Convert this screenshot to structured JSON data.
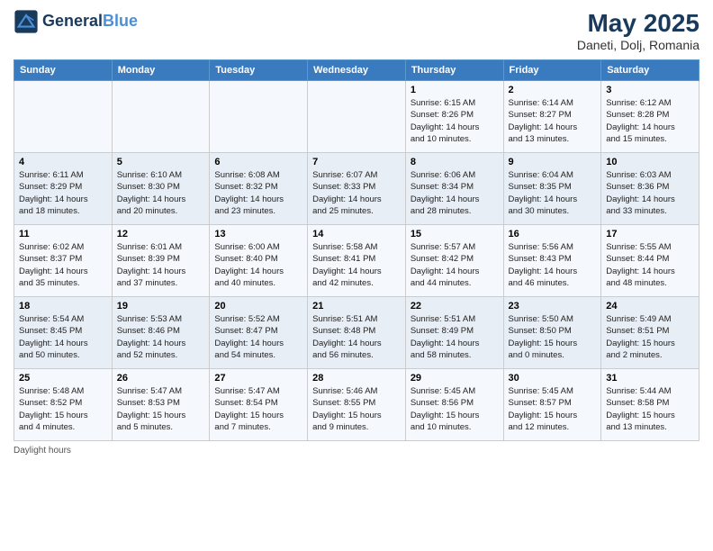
{
  "header": {
    "logo_line1": "General",
    "logo_line2": "Blue",
    "title": "May 2025",
    "location": "Daneti, Dolj, Romania"
  },
  "days_of_week": [
    "Sunday",
    "Monday",
    "Tuesday",
    "Wednesday",
    "Thursday",
    "Friday",
    "Saturday"
  ],
  "weeks": [
    [
      {
        "day": "",
        "info": ""
      },
      {
        "day": "",
        "info": ""
      },
      {
        "day": "",
        "info": ""
      },
      {
        "day": "",
        "info": ""
      },
      {
        "day": "1",
        "info": "Sunrise: 6:15 AM\nSunset: 8:26 PM\nDaylight: 14 hours\nand 10 minutes."
      },
      {
        "day": "2",
        "info": "Sunrise: 6:14 AM\nSunset: 8:27 PM\nDaylight: 14 hours\nand 13 minutes."
      },
      {
        "day": "3",
        "info": "Sunrise: 6:12 AM\nSunset: 8:28 PM\nDaylight: 14 hours\nand 15 minutes."
      }
    ],
    [
      {
        "day": "4",
        "info": "Sunrise: 6:11 AM\nSunset: 8:29 PM\nDaylight: 14 hours\nand 18 minutes."
      },
      {
        "day": "5",
        "info": "Sunrise: 6:10 AM\nSunset: 8:30 PM\nDaylight: 14 hours\nand 20 minutes."
      },
      {
        "day": "6",
        "info": "Sunrise: 6:08 AM\nSunset: 8:32 PM\nDaylight: 14 hours\nand 23 minutes."
      },
      {
        "day": "7",
        "info": "Sunrise: 6:07 AM\nSunset: 8:33 PM\nDaylight: 14 hours\nand 25 minutes."
      },
      {
        "day": "8",
        "info": "Sunrise: 6:06 AM\nSunset: 8:34 PM\nDaylight: 14 hours\nand 28 minutes."
      },
      {
        "day": "9",
        "info": "Sunrise: 6:04 AM\nSunset: 8:35 PM\nDaylight: 14 hours\nand 30 minutes."
      },
      {
        "day": "10",
        "info": "Sunrise: 6:03 AM\nSunset: 8:36 PM\nDaylight: 14 hours\nand 33 minutes."
      }
    ],
    [
      {
        "day": "11",
        "info": "Sunrise: 6:02 AM\nSunset: 8:37 PM\nDaylight: 14 hours\nand 35 minutes."
      },
      {
        "day": "12",
        "info": "Sunrise: 6:01 AM\nSunset: 8:39 PM\nDaylight: 14 hours\nand 37 minutes."
      },
      {
        "day": "13",
        "info": "Sunrise: 6:00 AM\nSunset: 8:40 PM\nDaylight: 14 hours\nand 40 minutes."
      },
      {
        "day": "14",
        "info": "Sunrise: 5:58 AM\nSunset: 8:41 PM\nDaylight: 14 hours\nand 42 minutes."
      },
      {
        "day": "15",
        "info": "Sunrise: 5:57 AM\nSunset: 8:42 PM\nDaylight: 14 hours\nand 44 minutes."
      },
      {
        "day": "16",
        "info": "Sunrise: 5:56 AM\nSunset: 8:43 PM\nDaylight: 14 hours\nand 46 minutes."
      },
      {
        "day": "17",
        "info": "Sunrise: 5:55 AM\nSunset: 8:44 PM\nDaylight: 14 hours\nand 48 minutes."
      }
    ],
    [
      {
        "day": "18",
        "info": "Sunrise: 5:54 AM\nSunset: 8:45 PM\nDaylight: 14 hours\nand 50 minutes."
      },
      {
        "day": "19",
        "info": "Sunrise: 5:53 AM\nSunset: 8:46 PM\nDaylight: 14 hours\nand 52 minutes."
      },
      {
        "day": "20",
        "info": "Sunrise: 5:52 AM\nSunset: 8:47 PM\nDaylight: 14 hours\nand 54 minutes."
      },
      {
        "day": "21",
        "info": "Sunrise: 5:51 AM\nSunset: 8:48 PM\nDaylight: 14 hours\nand 56 minutes."
      },
      {
        "day": "22",
        "info": "Sunrise: 5:51 AM\nSunset: 8:49 PM\nDaylight: 14 hours\nand 58 minutes."
      },
      {
        "day": "23",
        "info": "Sunrise: 5:50 AM\nSunset: 8:50 PM\nDaylight: 15 hours\nand 0 minutes."
      },
      {
        "day": "24",
        "info": "Sunrise: 5:49 AM\nSunset: 8:51 PM\nDaylight: 15 hours\nand 2 minutes."
      }
    ],
    [
      {
        "day": "25",
        "info": "Sunrise: 5:48 AM\nSunset: 8:52 PM\nDaylight: 15 hours\nand 4 minutes."
      },
      {
        "day": "26",
        "info": "Sunrise: 5:47 AM\nSunset: 8:53 PM\nDaylight: 15 hours\nand 5 minutes."
      },
      {
        "day": "27",
        "info": "Sunrise: 5:47 AM\nSunset: 8:54 PM\nDaylight: 15 hours\nand 7 minutes."
      },
      {
        "day": "28",
        "info": "Sunrise: 5:46 AM\nSunset: 8:55 PM\nDaylight: 15 hours\nand 9 minutes."
      },
      {
        "day": "29",
        "info": "Sunrise: 5:45 AM\nSunset: 8:56 PM\nDaylight: 15 hours\nand 10 minutes."
      },
      {
        "day": "30",
        "info": "Sunrise: 5:45 AM\nSunset: 8:57 PM\nDaylight: 15 hours\nand 12 minutes."
      },
      {
        "day": "31",
        "info": "Sunrise: 5:44 AM\nSunset: 8:58 PM\nDaylight: 15 hours\nand 13 minutes."
      }
    ]
  ],
  "footer": "Daylight hours"
}
